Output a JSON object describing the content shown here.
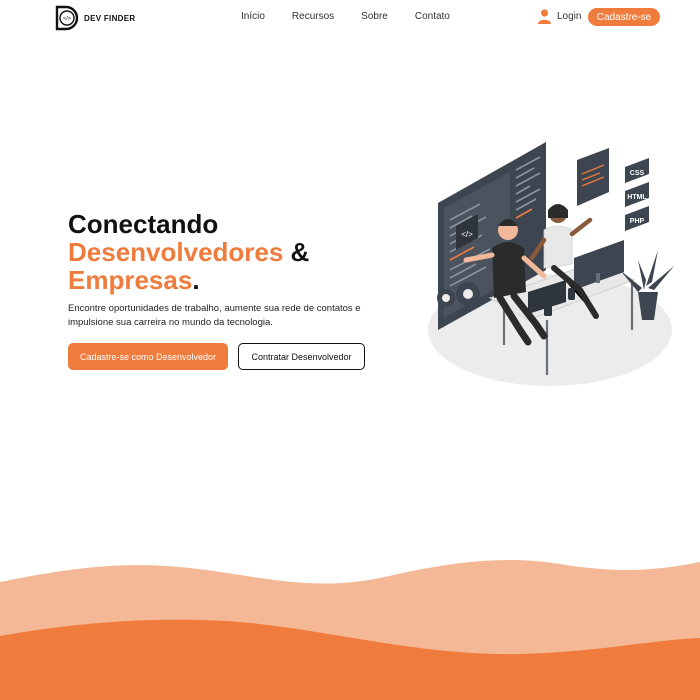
{
  "brand": {
    "name": "DEV FINDER",
    "logo_glyph": "</>"
  },
  "nav": {
    "items": [
      {
        "label": "Início"
      },
      {
        "label": "Recursos"
      },
      {
        "label": "Sobre"
      },
      {
        "label": "Contato"
      }
    ]
  },
  "auth": {
    "login_label": "Login",
    "signup_label": "Cadastre-se"
  },
  "hero": {
    "title_line1": "Conectando",
    "title_line2_orange": "Desenvolvedores",
    "title_line2_rest": " &",
    "title_line3_orange": "Empresas",
    "title_line3_rest": ".",
    "description": "Encontre oportunidades de trabalho, aumente sua rede de contatos e impulsione sua carreira no mundo da tecnologia.",
    "primary_cta": "Cadastre-se como Desenvolvedor",
    "secondary_cta": "Contratar Desenvolvedor"
  },
  "illustration": {
    "tags": [
      "CSS",
      "HTML",
      "PHP"
    ],
    "code_glyph": "</>"
  },
  "colors": {
    "accent": "#ef7b3c",
    "accent_light": "#f5b896",
    "text": "#111111"
  }
}
